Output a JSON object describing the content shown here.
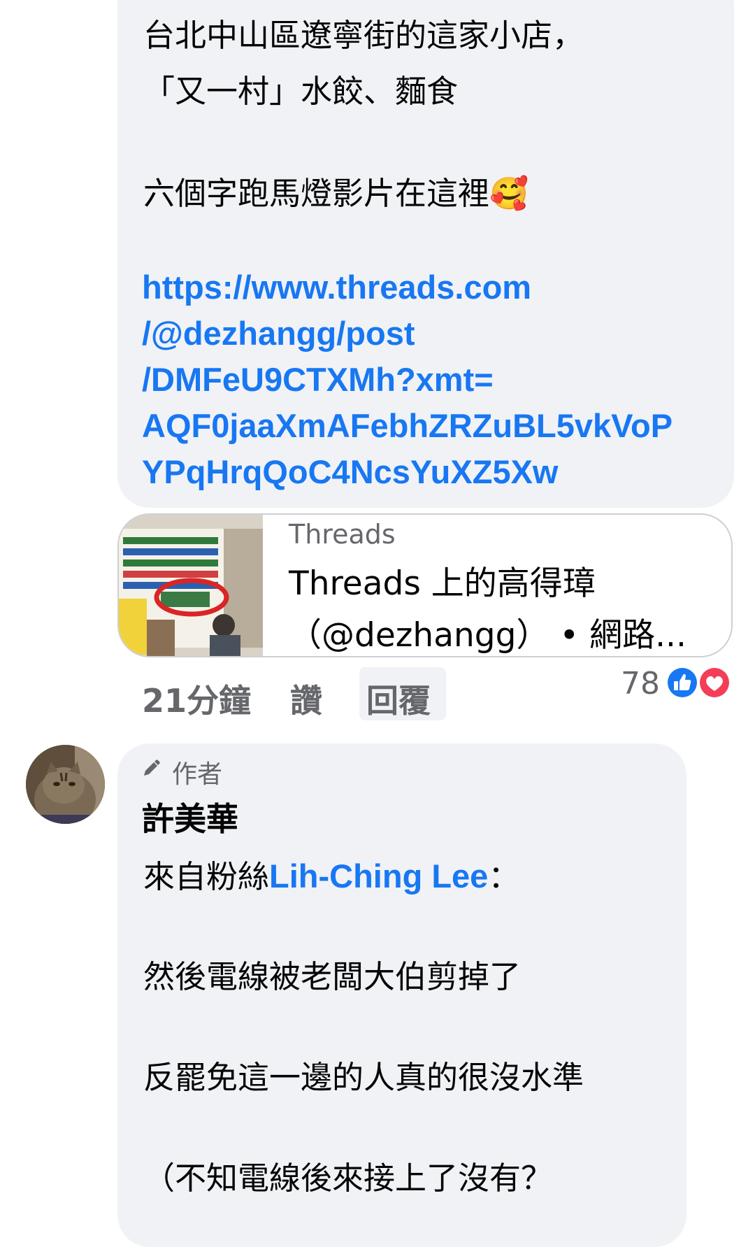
{
  "post1": {
    "line1": "台北中山區遼寧街的這家小店，",
    "line2": "「又一村」水餃、麵食",
    "line3": "六個字跑馬燈影片在這裡🥰",
    "link_lines": [
      "https://www.threads.com",
      "/@dezhangg/post",
      "/DMFeU9CTXMh?xmt=",
      "AQF0jaaXmAFebhZRZuBL5vkVoP",
      "YPqHrqQoC4NcsYuXZ5Xw"
    ],
    "card": {
      "source": "Threads",
      "title_line1": "Threads 上的高得璋",
      "title_line2": "（@dezhangg） • 網路..."
    }
  },
  "actions": {
    "time": "21分鐘",
    "like": "讚",
    "reply": "回覆",
    "reaction_count": "78"
  },
  "comment": {
    "badge": "作者",
    "author": "許美華",
    "intro_prefix": "來自粉絲",
    "intro_name": "Lih-Ching Lee",
    "intro_suffix": "：",
    "line1": "然後電線被老闆大伯剪掉了",
    "line2": "反罷免這一邊的人真的很沒水準",
    "line3": "（不知電線後來接上了沒有？"
  },
  "colors": {
    "link": "#1877f2",
    "bubble": "#f0f2f5",
    "secondary_text": "#65676b",
    "like_blue": "#1877f2",
    "love_red": "#f33e58"
  },
  "icons": [
    "pencil-icon",
    "like-reaction-icon",
    "love-reaction-icon"
  ]
}
